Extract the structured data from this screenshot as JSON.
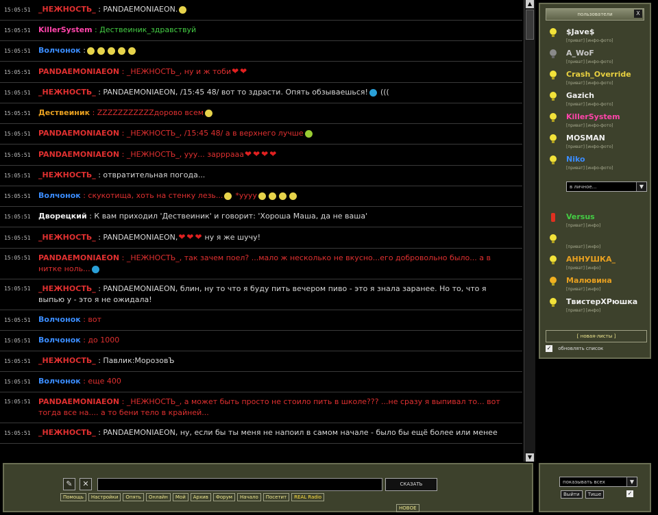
{
  "chat": {
    "messages": [
      {
        "time": "15:05:51",
        "nick": "_НЕЖНОСТЬ_",
        "nick_color": "#e03030",
        "text": ": PANDAEMONIAEON.",
        "text_color": "#d8d8d8",
        "emojis": [
          "smile"
        ]
      },
      {
        "time": "15:05:51",
        "nick": "KillerSystem",
        "nick_color": "#ff44aa",
        "text": ": Дествеиник_здравствуй",
        "text_color": "#44cc44",
        "emojis": []
      },
      {
        "time": "15:05:51",
        "nick": "Волчонок",
        "nick_color": "#3b8dff",
        "text": ":",
        "text_color": "#d8d8d8",
        "emojis": [
          "smile",
          "smile",
          "smile",
          "smile",
          "smile"
        ]
      },
      {
        "time": "15:05:51",
        "nick": "PANDAEMONIAEON",
        "nick_color": "#e03030",
        "text": ": _НЕЖНОСТЬ_, ну и ж тоби",
        "text_color": "#e03030",
        "emojis": [
          "heart",
          "heart"
        ]
      },
      {
        "time": "15:05:51",
        "nick": "_НЕЖНОСТЬ_",
        "nick_color": "#e03030",
        "text": ": PANDAEMONIAEON, /15:45 48/ вот то здрасти. Опять обзываешься!",
        "text_color": "#d8d8d8",
        "emojis": [
          "blue",
          "text:((("
        ]
      },
      {
        "time": "15:05:51",
        "nick": "Дествеиник",
        "nick_color": "#e8a020",
        "text": ": ZZZZZZZZZZZдорово всем",
        "text_color": "#e03030",
        "emojis": [
          "smile"
        ]
      },
      {
        "time": "15:05:51",
        "nick": "PANDAEMONIAEON",
        "nick_color": "#e03030",
        "text": ": _НЕЖНОСТЬ_, /15:45 48/ а в верхнего лучше",
        "text_color": "#e03030",
        "emojis": [
          "green"
        ]
      },
      {
        "time": "15:05:51",
        "nick": "PANDAEMONIAEON",
        "nick_color": "#e03030",
        "text": ": _НЕЖНОСТЬ_, ууу... зарррааа",
        "text_color": "#e03030",
        "emojis": [
          "heart",
          "heart",
          "heart",
          "heart"
        ]
      },
      {
        "time": "15:05:51",
        "nick": "_НЕЖНОСТЬ_",
        "nick_color": "#e03030",
        "text": ": отвратительная погода...",
        "text_color": "#d8d8d8",
        "emojis": []
      },
      {
        "time": "15:05:51",
        "nick": "Волчонок",
        "nick_color": "#3b8dff",
        "text": ": скукотища, хоть на стенку лезь...",
        "text_color": "#e03030",
        "emojis": [
          "smile",
          "text:*уууу",
          "smile",
          "smile",
          "smile",
          "smile"
        ]
      },
      {
        "time": "15:05:51",
        "nick": "Дворецкий",
        "nick_color": "#f0f0f0",
        "text": ": К вам приходил 'Дествеиник' и говорит: 'Хороша Маша, да не ваша'",
        "text_color": "#d8d8d8",
        "emojis": []
      },
      {
        "time": "15:05:51",
        "nick": "_НЕЖНОСТЬ_",
        "nick_color": "#e03030",
        "text": ": PANDAEMONIAEON,",
        "text_color": "#d8d8d8",
        "emojis": [
          "heart",
          "heart",
          "heart",
          "text:ну я же шучу!"
        ]
      },
      {
        "time": "15:05:51",
        "nick": "PANDAEMONIAEON",
        "nick_color": "#e03030",
        "text": ": _НЕЖНОСТЬ_, так зачем поел? ...мало ж несколько не вкусно...его добровольно было... а в нитке ноль...",
        "text_color": "#e03030",
        "emojis": [
          "blue"
        ],
        "two_line": true
      },
      {
        "time": "15:05:51",
        "nick": "_НЕЖНОСТЬ_",
        "nick_color": "#e03030",
        "text": ": PANDAEMONIAEON, блин, ну то что я буду пить вечером пиво - это я знала заранее. Но то, что я выпью у - это я не ожидала!",
        "text_color": "#d8d8d8",
        "emojis": [],
        "two_line": true
      },
      {
        "time": "15:05:51",
        "nick": "Волчонок",
        "nick_color": "#3b8dff",
        "text": ": вот",
        "text_color": "#e03030",
        "emojis": []
      },
      {
        "time": "15:05:51",
        "nick": "Волчонок",
        "nick_color": "#3b8dff",
        "text": ": до 1000",
        "text_color": "#e03030",
        "emojis": []
      },
      {
        "time": "15:05:51",
        "nick": "_НЕЖНОСТЬ_",
        "nick_color": "#e03030",
        "text": ": Павлик:МорозовЪ",
        "text_color": "#d8d8d8",
        "emojis": []
      },
      {
        "time": "15:05:51",
        "nick": "Волчонок",
        "nick_color": "#3b8dff",
        "text": ": еще 400",
        "text_color": "#e03030",
        "emojis": []
      },
      {
        "time": "15:05:51",
        "nick": "PANDAEMONIAEON",
        "nick_color": "#e03030",
        "text": ": _НЕЖНОСТЬ_, а может быть просто не стоило пить в школе??? ...не сразу я выпивал то... вот тогда все на.... а то бени тело в крайней...",
        "text_color": "#e03030",
        "emojis": [],
        "two_line": true
      },
      {
        "time": "15:05:51",
        "nick": "_НЕЖНОСТЬ_",
        "nick_color": "#e03030",
        "text": ": PANDAEMONIAEON, ну, если бы ты меня не напоил в самом начале - было бы ещё более или менее",
        "text_color": "#d8d8d8",
        "emojis": []
      }
    ]
  },
  "users_panel": {
    "header": "пользователи",
    "close": "X",
    "users": [
      {
        "name": "$Jave$",
        "color": "#f0f0f0",
        "sub": "[приват] [инфо-фото]",
        "bulb": "yellow"
      },
      {
        "name": "A_WoF",
        "color": "#c8c8c8",
        "sub": "[приват] [инфо-фото]",
        "bulb": "grey"
      },
      {
        "name": "Crash_Override",
        "color": "#e8d040",
        "sub": "[приват] [инфо-фото]",
        "bulb": "yellow"
      },
      {
        "name": "Gazich",
        "color": "#f0f0f0",
        "sub": "[приват] [инфо-фото]",
        "bulb": "yellow"
      },
      {
        "name": "KillerSystem",
        "color": "#ff44aa",
        "sub": "[приват] [инфо-фото]",
        "bulb": "yellow"
      },
      {
        "name": "MOSMAN",
        "color": "#f0f0f0",
        "sub": "[приват] [инфо-фото]",
        "bulb": "yellow"
      },
      {
        "name": "Niko",
        "color": "#3b8dff",
        "sub": "[приват] [инфо-фото]",
        "bulb": "yellow"
      }
    ],
    "users2": [
      {
        "name": "Versus",
        "color": "#44cc44",
        "sub": "[приват] [инфо]",
        "bulb": "red"
      },
      {
        "name": "",
        "color": "#e03030",
        "sub": "[приват] [инфо]",
        "bulb": "yellow"
      },
      {
        "name": "АННУШКА_",
        "color": "#e8a020",
        "sub": "[приват] [инфо]",
        "bulb": "yellow"
      },
      {
        "name": "Малювина",
        "color": "#e8a020",
        "sub": "[приват] [инфо]",
        "bulb": "orange"
      },
      {
        "name": "ТвистерХРюшка",
        "color": "#f0f0f0",
        "sub": "[приват] [инфо]",
        "bulb": "yellow"
      }
    ],
    "select_value": "в личное...",
    "footer": "[ новая-листы ]",
    "refresh_label": "обновлять список",
    "refresh_check": "✓"
  },
  "bottom": {
    "say_label": "СКАЗАТЬ",
    "links": [
      "Помощь",
      "Настройки",
      "Опять",
      "Онлайн",
      "Мой",
      "Архив",
      "Форум",
      "Начало",
      "Посетит",
      "REAL Radio"
    ],
    "mode_label": "НОВОЕ",
    "icon_pen": "✎",
    "icon_x": "✕"
  },
  "opts": {
    "select_value": "показывать всех",
    "btn1": "Выйти",
    "btn2": "Тише",
    "check": "✓"
  },
  "scroll": {
    "up": "▲",
    "down": "▼"
  }
}
